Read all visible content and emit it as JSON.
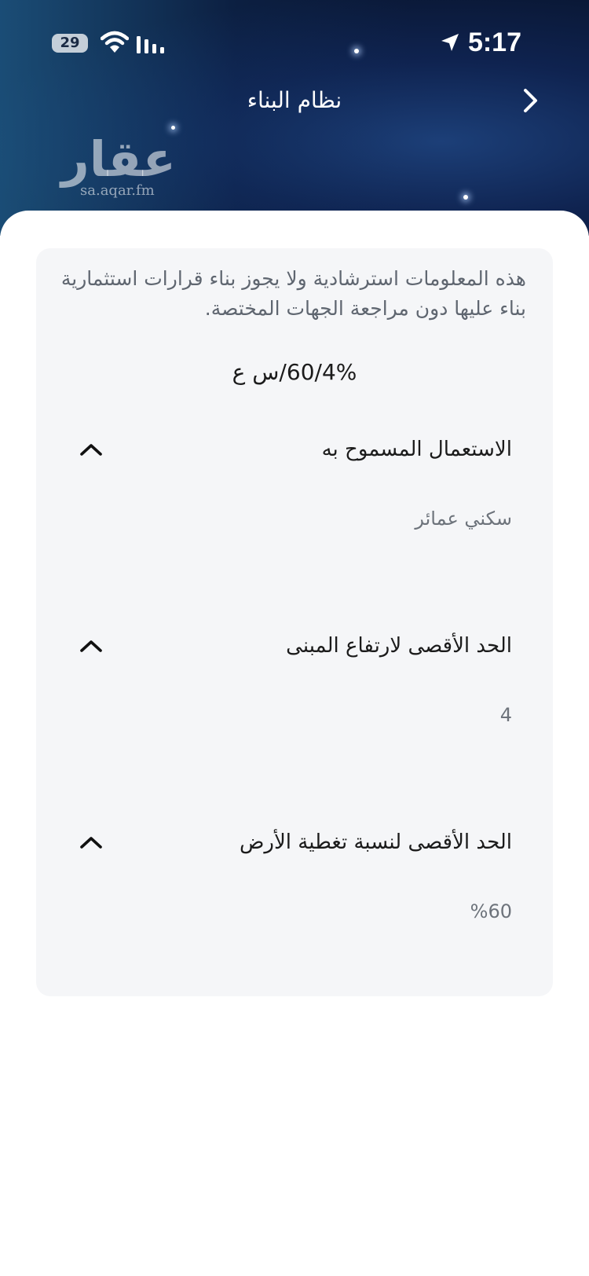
{
  "status_bar": {
    "battery": "29",
    "time": "5:17"
  },
  "header": {
    "title": "نظام البناء",
    "back_icon": "chevron-right-icon"
  },
  "watermark": {
    "arabic": "عقار",
    "domain": "sa.aqar.fm"
  },
  "card": {
    "disclaimer": "هذه المعلومات استرشادية ولا يجوز بناء قرارات استثمارية بناء عليها دون مراجعة الجهات المختصة.",
    "code": "60/4%/س ع",
    "sections": [
      {
        "title": "الاستعمال المسموح به",
        "value": "سكني عمائر",
        "icon": "chevron-up-icon"
      },
      {
        "title": "الحد الأقصى لارتفاع المبنى",
        "value": "4",
        "icon": "chevron-up-icon"
      },
      {
        "title": "الحد الأقصى لنسبة تغطية الأرض",
        "value": "%60",
        "icon": "chevron-up-icon"
      }
    ]
  },
  "colors": {
    "header_dark": "#0a1836",
    "card_bg": "#f5f6f8",
    "text_primary": "#1b1b1b",
    "text_secondary": "#6d737b"
  }
}
